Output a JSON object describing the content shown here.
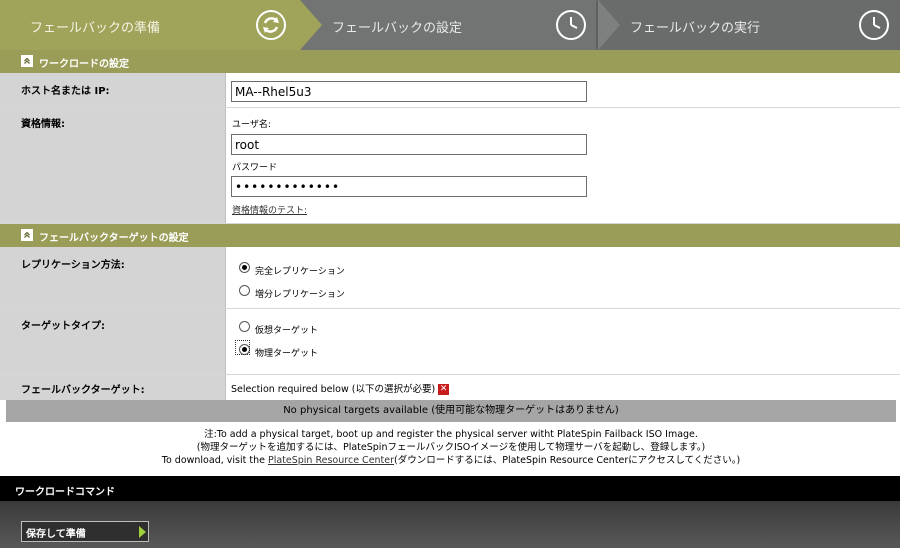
{
  "wizard": {
    "steps": [
      {
        "label": "フェールバックの準備",
        "icon": "refresh-icon",
        "state": "active"
      },
      {
        "label": "フェールバックの設定",
        "icon": "clock-icon",
        "state": "inactive"
      },
      {
        "label": "フェールバックの実行",
        "icon": "clock-icon",
        "state": "inactive"
      }
    ]
  },
  "workload_settings": {
    "title": "ワークロードの設定",
    "hostname_label": "ホスト名または IP:",
    "hostname_value": "MA--Rhel5u3",
    "credentials_label": "資格情報:",
    "username_label": "ユーザ名:",
    "username_value": "root",
    "password_label": "パスワード",
    "password_value": "•••••••••••••",
    "test_link": "資格情報のテスト:"
  },
  "target_settings": {
    "title": "フェールバックターゲットの設定",
    "replication_label": "レプリケーション方法:",
    "replication_options": [
      {
        "label": "完全レプリケーション",
        "checked": true
      },
      {
        "label": "増分レプリケーション",
        "checked": false
      }
    ],
    "target_type_label": "ターゲットタイプ:",
    "target_type_options": [
      {
        "label": "仮想ターゲット",
        "checked": false
      },
      {
        "label": "物理ターゲット",
        "checked": true
      }
    ],
    "failback_target_label": "フェールバックターゲット:",
    "selection_required": "Selection required below (以下の選択が必要)",
    "no_targets": "No physical targets available (使用可能な物理ターゲットはありません)",
    "note_line1": "注:To add a physical target, boot up and register the physical server witht PlateSpin Failback ISO Image.",
    "note_line2": "(物理ターゲットを追加するには、PlateSpinフェールバックISOイメージを使用して物理サーバを起動し、登録します。)",
    "note_line3_prefix": "To download, visit the ",
    "note_link": "PlateSpin Resource Center",
    "note_line3_suffix": "(ダウンロードするには、PlateSpin Resource Centerにアクセスしてください。)"
  },
  "commands": {
    "title": "ワークロードコマンド",
    "save_button": "保存して準備"
  },
  "colors": {
    "olive": "#9a9d58",
    "label_bg": "#d4d4d4",
    "error": "#c81c1c",
    "arrow_green": "#9fcf3a"
  }
}
